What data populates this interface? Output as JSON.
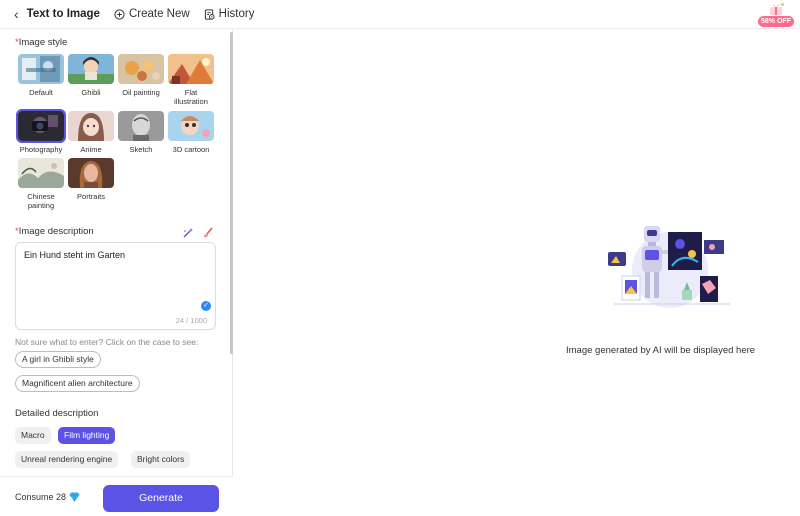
{
  "header": {
    "title": "Text to Image",
    "create_new": "Create New",
    "history": "History",
    "promo_badge": "58% OFF"
  },
  "sidebar": {
    "image_style_label": "Image style",
    "styles": [
      {
        "label": "Default",
        "selected": false
      },
      {
        "label": "Ghibli",
        "selected": false
      },
      {
        "label": "Oil painting",
        "selected": false
      },
      {
        "label": "Flat illustration",
        "selected": false
      },
      {
        "label": "Photography",
        "selected": true
      },
      {
        "label": "Anime",
        "selected": false
      },
      {
        "label": "Sketch",
        "selected": false
      },
      {
        "label": "3D cartoon",
        "selected": false
      },
      {
        "label": "Chinese painting",
        "selected": false
      },
      {
        "label": "Portraits",
        "selected": false
      }
    ],
    "image_description_label": "Image description",
    "description": {
      "value": "Ein Hund steht im Garten",
      "count": "24 / 1000"
    },
    "hint": "Not sure what to enter? Click on the case to see:",
    "examples": [
      "A girl in Ghibli style",
      "Magnificent alien architecture"
    ],
    "detailed_label": "Detailed description",
    "detail_chips": [
      {
        "label": "Macro",
        "active": false
      },
      {
        "label": "Film lighting",
        "active": true
      },
      {
        "label": "Unreal rendering engine",
        "active": false
      },
      {
        "label": "Bright colors",
        "active": false
      }
    ],
    "consume_label": "Consume 28",
    "generate_label": "Generate"
  },
  "main": {
    "placeholder_text": "Image generated by AI will be displayed here"
  },
  "colors": {
    "accent": "#5a53e6",
    "required_star": "#e5484d",
    "promo": "#ff6b8a",
    "check": "#2f89f5"
  },
  "icons": [
    "back-chevron-icon",
    "plus-circle-icon",
    "history-icon",
    "gift-icon",
    "magic-wand-icon",
    "brush-icon",
    "check-icon",
    "diamond-icon"
  ]
}
